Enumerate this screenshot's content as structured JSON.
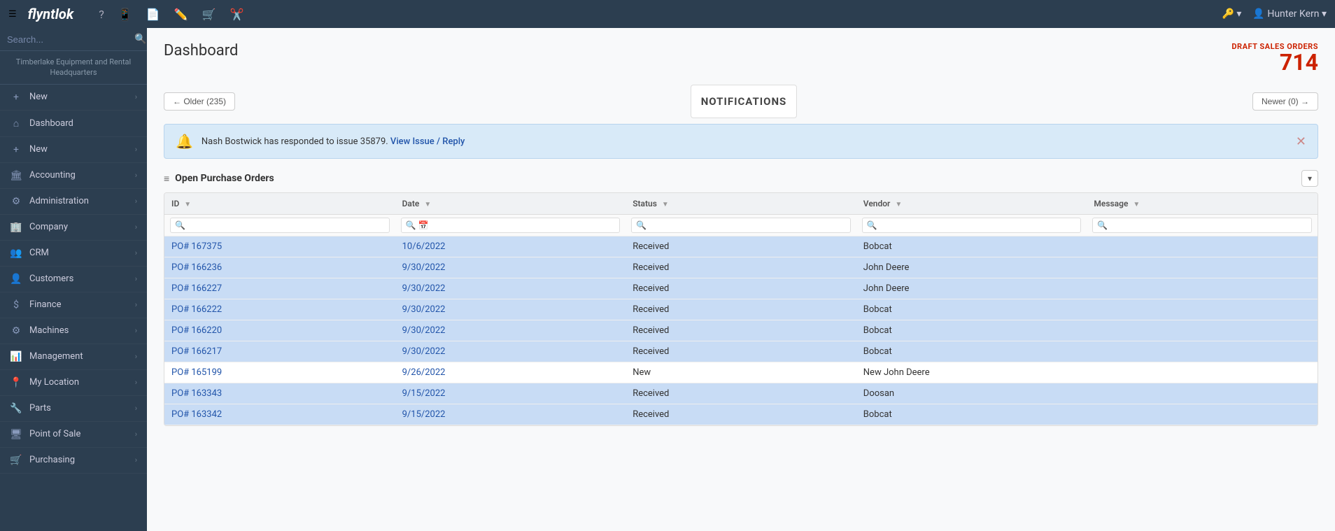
{
  "topNav": {
    "logoText": "flyntlok",
    "icons": [
      "?",
      "📱",
      "📄",
      "✏️",
      "🛒",
      "✂️"
    ],
    "rightItems": [
      "🔑 ▾",
      "👤 Hunter Kern ▾"
    ]
  },
  "sidebar": {
    "searchPlaceholder": "Search...",
    "companyName": "Timberlake Equipment and Rental Headquarters",
    "items": [
      {
        "id": "new1",
        "label": "New",
        "icon": "+",
        "hasChevron": true
      },
      {
        "id": "dashboard",
        "label": "Dashboard",
        "icon": "⌂",
        "hasChevron": false
      },
      {
        "id": "new2",
        "label": "New",
        "icon": "+",
        "hasChevron": true
      },
      {
        "id": "accounting",
        "label": "Accounting",
        "icon": "🏛",
        "hasChevron": true
      },
      {
        "id": "administration",
        "label": "Administration",
        "icon": "⚙",
        "hasChevron": true
      },
      {
        "id": "company",
        "label": "Company",
        "icon": "🏢",
        "hasChevron": true
      },
      {
        "id": "crm",
        "label": "CRM",
        "icon": "👥",
        "hasChevron": true
      },
      {
        "id": "customers",
        "label": "Customers",
        "icon": "👤",
        "hasChevron": true
      },
      {
        "id": "finance",
        "label": "Finance",
        "icon": "$",
        "hasChevron": true
      },
      {
        "id": "machines",
        "label": "Machines",
        "icon": "⚙",
        "hasChevron": true
      },
      {
        "id": "management",
        "label": "Management",
        "icon": "📊",
        "hasChevron": true
      },
      {
        "id": "my-location",
        "label": "My Location",
        "icon": "📍",
        "hasChevron": true
      },
      {
        "id": "parts",
        "label": "Parts",
        "icon": "🔧",
        "hasChevron": true
      },
      {
        "id": "point-of-sale",
        "label": "Point of Sale",
        "icon": "🖥",
        "hasChevron": true
      },
      {
        "id": "purchasing",
        "label": "Purchasing",
        "icon": "🛒",
        "hasChevron": true
      }
    ]
  },
  "mainHeader": {
    "title": "Dashboard",
    "draftLabel": "DRAFT SALES ORDERS",
    "draftCount": "714"
  },
  "notifications": {
    "olderBtn": "← Older (235)",
    "newerBtn": "Newer (0) →",
    "boxLabel": "NOTIFICATIONS",
    "banner": {
      "message": "Nash Bostwick has responded to issue 35879.",
      "linkText": "View Issue / Reply"
    }
  },
  "purchaseOrders": {
    "sectionTitle": "Open Purchase Orders",
    "columns": [
      "ID",
      "Date",
      "Status",
      "Vendor",
      "Message"
    ],
    "rows": [
      {
        "id": "PO# 167375",
        "date": "10/6/2022",
        "status": "Received",
        "vendor": "Bobcat",
        "message": "",
        "highlighted": true
      },
      {
        "id": "PO# 166236",
        "date": "9/30/2022",
        "status": "Received",
        "vendor": "John Deere",
        "message": "",
        "highlighted": true
      },
      {
        "id": "PO# 166227",
        "date": "9/30/2022",
        "status": "Received",
        "vendor": "John Deere",
        "message": "",
        "highlighted": true
      },
      {
        "id": "PO# 166222",
        "date": "9/30/2022",
        "status": "Received",
        "vendor": "Bobcat",
        "message": "",
        "highlighted": true
      },
      {
        "id": "PO# 166220",
        "date": "9/30/2022",
        "status": "Received",
        "vendor": "Bobcat",
        "message": "",
        "highlighted": true
      },
      {
        "id": "PO# 166217",
        "date": "9/30/2022",
        "status": "Received",
        "vendor": "Bobcat",
        "message": "",
        "highlighted": true
      },
      {
        "id": "PO# 165199",
        "date": "9/26/2022",
        "status": "New",
        "vendor": "New John Deere",
        "message": "",
        "highlighted": false
      },
      {
        "id": "PO# 163343",
        "date": "9/15/2022",
        "status": "Received",
        "vendor": "Doosan",
        "message": "",
        "highlighted": true
      },
      {
        "id": "PO# 163342",
        "date": "9/15/2022",
        "status": "Received",
        "vendor": "Bobcat",
        "message": "",
        "highlighted": true
      }
    ]
  }
}
